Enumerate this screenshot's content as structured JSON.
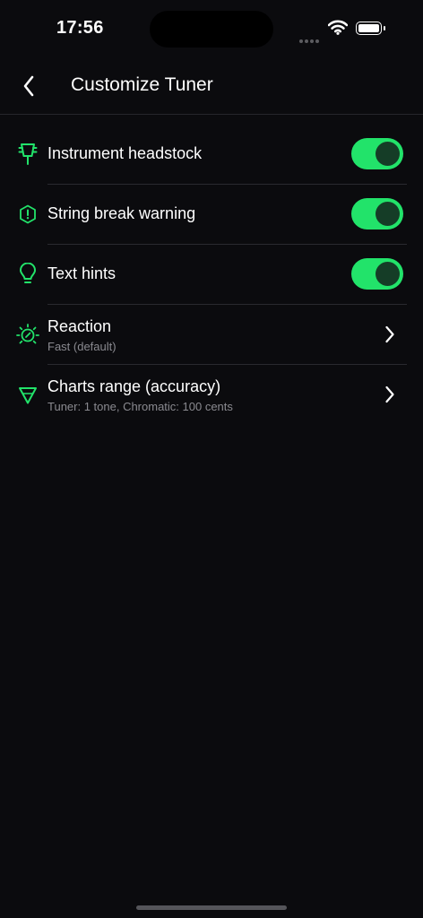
{
  "status_bar": {
    "time": "17:56"
  },
  "header": {
    "title": "Customize Tuner"
  },
  "settings": [
    {
      "label": "Instrument headstock",
      "icon": "headstock-icon",
      "toggle_on": true
    },
    {
      "label": "String break warning",
      "icon": "warning-icon",
      "toggle_on": true
    },
    {
      "label": "Text hints",
      "icon": "lightbulb-icon",
      "toggle_on": true
    },
    {
      "label": "Reaction",
      "subtitle": "Fast (default)",
      "icon": "reaction-icon"
    },
    {
      "label": "Charts range (accuracy)",
      "subtitle": "Tuner: 1 tone, Chromatic: 100 cents",
      "icon": "range-icon"
    }
  ],
  "colors": {
    "accent": "#22e36a",
    "background": "#0b0b0e",
    "knob": "#153d27"
  }
}
